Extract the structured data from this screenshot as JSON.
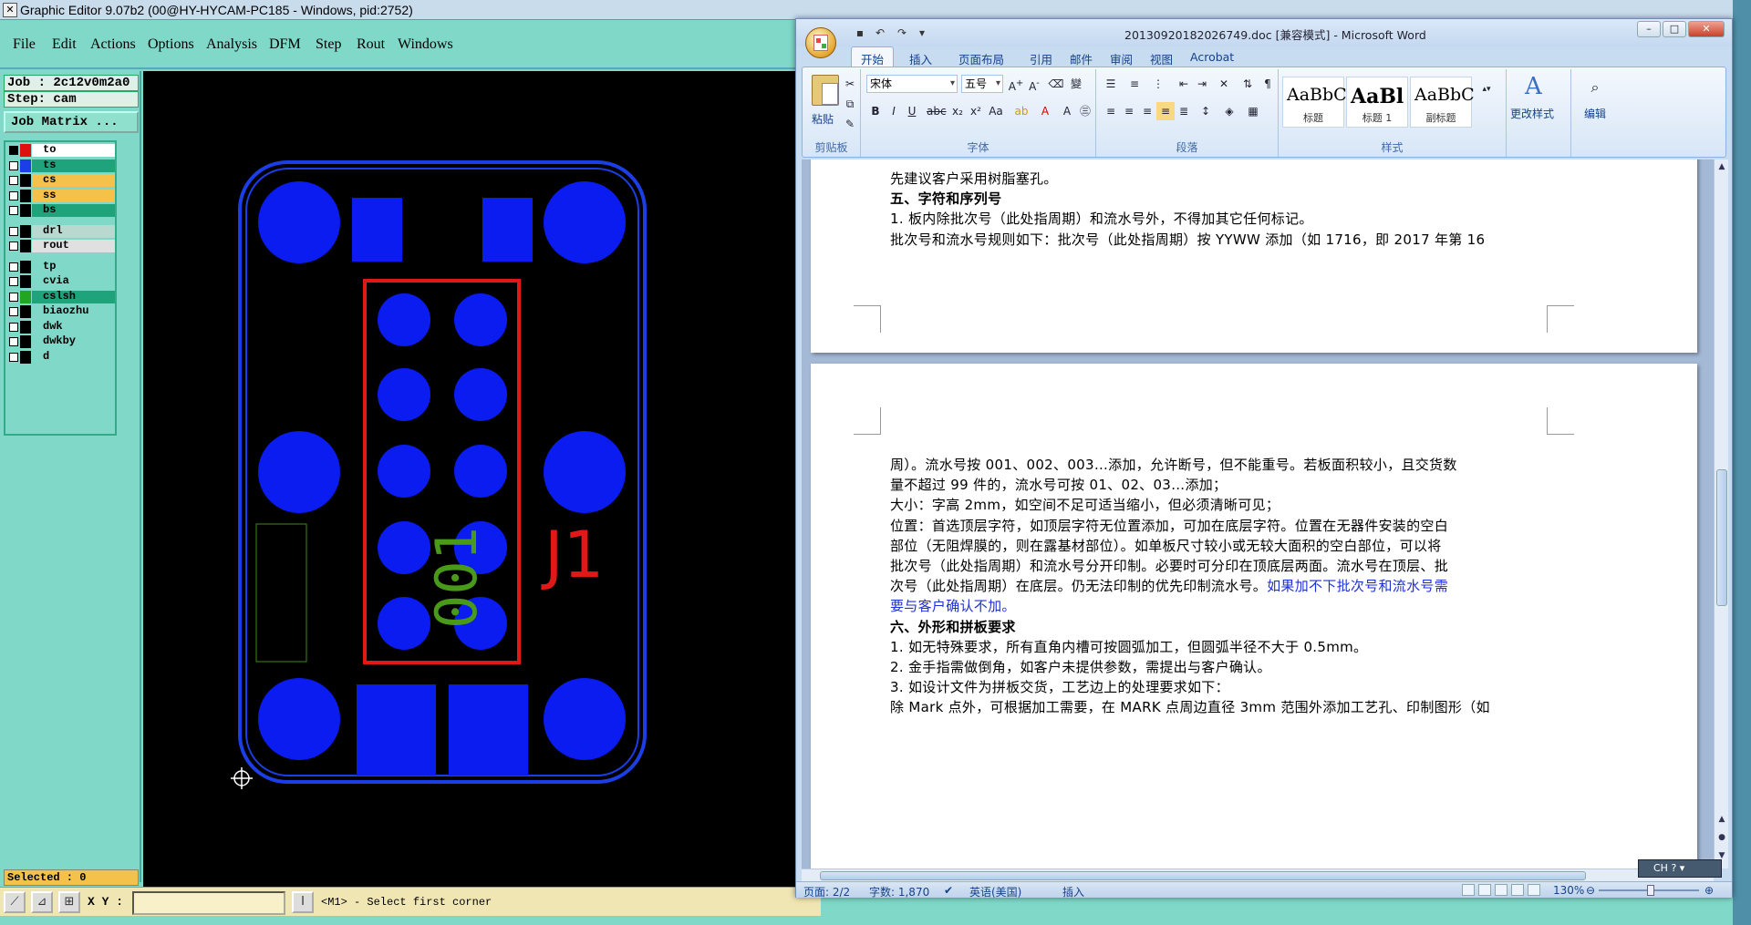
{
  "ge": {
    "title": "Graphic Editor 9.07b2 (00@HY-HYCAM-PC185 - Windows, pid:2752)",
    "menus": [
      "File",
      "Edit",
      "Actions",
      "Options",
      "Analysis",
      "DFM",
      "Step",
      "Rout",
      "Windows"
    ],
    "job": "Job : 2c12v0m2a0",
    "step": "Step: cam",
    "job_matrix": "Job Matrix ...",
    "layers": [
      {
        "name": "to",
        "swatch": "#e01010",
        "bg": "#ffffff",
        "checked": true
      },
      {
        "name": "ts",
        "swatch": "#1b3ee6",
        "bg": "#1ea37a",
        "checked": false
      },
      {
        "name": "cs",
        "swatch": "#000000",
        "bg": "#f4c24a",
        "checked": false
      },
      {
        "name": "ss",
        "swatch": "#000000",
        "bg": "#f4c24a",
        "checked": false
      },
      {
        "name": "bs",
        "swatch": "#000000",
        "bg": "#1ea37a",
        "checked": false
      },
      {
        "name": "drl",
        "swatch": "#000000",
        "bg": "#b8d8d0",
        "checked": false
      },
      {
        "name": "rout",
        "swatch": "#000000",
        "bg": "#e0e0e0",
        "checked": false
      },
      {
        "name": "tp",
        "swatch": "#000000",
        "bg": "#7fd8c8",
        "checked": false
      },
      {
        "name": "cvia",
        "swatch": "#000000",
        "bg": "#7fd8c8",
        "checked": false
      },
      {
        "name": "cslsh",
        "swatch": "#22a622",
        "bg": "#1ea37a",
        "checked": false
      },
      {
        "name": "biaozhu",
        "swatch": "#000000",
        "bg": "#7fd8c8",
        "checked": false
      },
      {
        "name": "dwk",
        "swatch": "#000000",
        "bg": "#7fd8c8",
        "checked": false
      },
      {
        "name": "dwkby",
        "swatch": "#000000",
        "bg": "#7fd8c8",
        "checked": false
      },
      {
        "name": "d",
        "swatch": "#000000",
        "bg": "#7fd8c8",
        "checked": false
      }
    ],
    "selected": "Selected : 0",
    "xy_label": "X Y :",
    "xy_value": "",
    "prompt": "<M1> - Select first corner",
    "canvas": {
      "ref_label": "J1",
      "serial_label": "001",
      "colors": {
        "copper": "#0a1cf0",
        "outline": "#1b3ee6",
        "silk_red": "#e01818",
        "silk_green": "#4a9a1a"
      }
    }
  },
  "word": {
    "title": "20130920182026749.doc [兼容模式] - Microsoft Word",
    "tabs": [
      "开始",
      "插入",
      "页面布局",
      "引用",
      "邮件",
      "审阅",
      "视图",
      "Acrobat"
    ],
    "active_tab": "开始",
    "ribbon": {
      "paste": "粘贴",
      "clipboard_group": "剪贴板",
      "font_name": "宋体",
      "font_size": "五号",
      "font_group": "字体",
      "paragraph_group": "段落",
      "styles": [
        {
          "sample": "AaBbC",
          "name": "标题"
        },
        {
          "sample": "AaBl",
          "name": "标题 1"
        },
        {
          "sample": "AaBbC",
          "name": "副标题"
        }
      ],
      "change_styles": "更改样式",
      "styles_group": "样式",
      "edit": "编辑"
    },
    "page1_lines": [
      {
        "text": "先建议客户采用树脂塞孔。",
        "bold": false
      },
      {
        "text": "五、字符和序列号",
        "bold": true
      },
      {
        "text": "1. 板内除批次号（此处指周期）和流水号外，不得加其它任何标记。",
        "bold": false
      },
      {
        "text": "批次号和流水号规则如下：批次号（此处指周期）按 YYWW 添加（如 1716，即 2017 年第 16",
        "bold": false
      }
    ],
    "page2_lines": [
      {
        "text": "周）。流水号按 001、002、003…添加，允许断号，但不能重号。若板面积较小，且交货数",
        "bold": false
      },
      {
        "text": "量不超过 99 件的，流水号可按 01、02、03…添加；",
        "bold": false
      },
      {
        "text": "大小：字高 2mm，如空间不足可适当缩小，但必须清晰可见；",
        "bold": false
      },
      {
        "text": "位置：首选顶层字符，如顶层字符无位置添加，可加在底层字符。位置在无器件安装的空白",
        "bold": false
      },
      {
        "text": "部位（无阻焊膜的，则在露基材部位）。如单板尺寸较小或无较大面积的空白部位，可以将",
        "bold": false
      },
      {
        "text": "批次号（此处指周期）和流水号分开印制。必要时可分印在顶底层两面。流水号在顶层、批",
        "bold": false
      },
      {
        "text": "次号（此处指周期）在底层。仍无法印制的优先印制流水号。",
        "bold": false,
        "link": "如果加不下批次号和流水号需"
      },
      {
        "text": "",
        "bold": false,
        "link": "要与客户确认不加。"
      },
      {
        "text": "六、外形和拼板要求",
        "bold": true
      },
      {
        "text": "1. 如无特殊要求，所有直角内槽可按圆弧加工，但圆弧半径不大于 0.5mm。",
        "bold": false
      },
      {
        "text": "2. 金手指需做倒角，如客户未提供参数，需提出与客户确认。",
        "bold": false
      },
      {
        "text": "3. 如设计文件为拼板交货，工艺边上的处理要求如下：",
        "bold": false
      },
      {
        "text": "除 Mark 点外，可根据加工需要，在 MARK 点周边直径 3mm 范围外添加工艺孔、印制图形（如",
        "bold": false
      }
    ],
    "status": {
      "page": "页面: 2/2",
      "words": "字数: 1,870",
      "lang": "英语(美国)",
      "mode": "插入",
      "zoom": "130%"
    },
    "ime": "CH"
  }
}
